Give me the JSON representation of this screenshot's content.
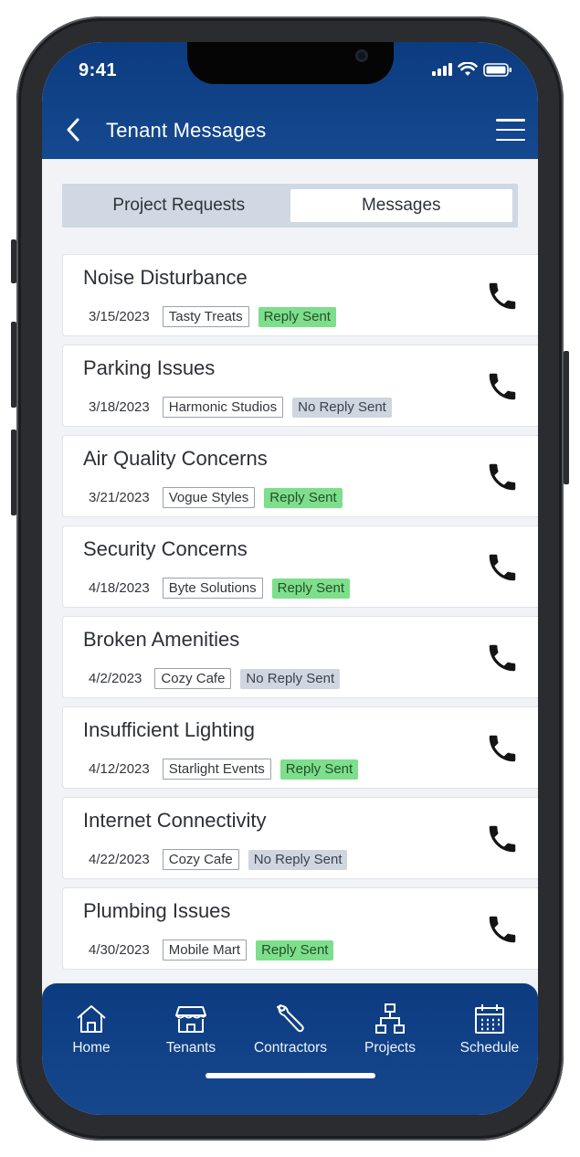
{
  "status_bar": {
    "time": "9:41"
  },
  "header": {
    "title": "Tenant Messages"
  },
  "tabs": [
    {
      "label": "Project Requests",
      "active": false
    },
    {
      "label": "Messages",
      "active": true
    }
  ],
  "messages": [
    {
      "title": "Noise Disturbance",
      "date": "3/15/2023",
      "tenant": "Tasty Treats",
      "status": "Reply Sent"
    },
    {
      "title": "Parking Issues",
      "date": "3/18/2023",
      "tenant": "Harmonic Studios",
      "status": "No Reply Sent"
    },
    {
      "title": "Air Quality Concerns",
      "date": "3/21/2023",
      "tenant": "Vogue Styles",
      "status": "Reply Sent"
    },
    {
      "title": "Security Concerns",
      "date": "4/18/2023",
      "tenant": "Byte Solutions",
      "status": "Reply Sent"
    },
    {
      "title": "Broken Amenities",
      "date": "4/2/2023",
      "tenant": "Cozy Cafe",
      "status": "No Reply Sent"
    },
    {
      "title": "Insufficient Lighting",
      "date": "4/12/2023",
      "tenant": "Starlight Events",
      "status": "Reply Sent"
    },
    {
      "title": "Internet Connectivity",
      "date": "4/22/2023",
      "tenant": "Cozy Cafe",
      "status": "No Reply Sent"
    },
    {
      "title": "Plumbing Issues",
      "date": "4/30/2023",
      "tenant": "Mobile Mart",
      "status": "Reply Sent"
    }
  ],
  "bottom_nav": [
    {
      "label": "Home",
      "icon": "home-icon"
    },
    {
      "label": "Tenants",
      "icon": "storefront-icon"
    },
    {
      "label": "Contractors",
      "icon": "wrench-icon"
    },
    {
      "label": "Projects",
      "icon": "sitemap-icon"
    },
    {
      "label": "Schedule",
      "icon": "calendar-icon"
    }
  ],
  "colors": {
    "header_bg": "#0c3b80",
    "reply_sent": "#7ddf8b",
    "no_reply_sent": "#cfd6e0"
  }
}
